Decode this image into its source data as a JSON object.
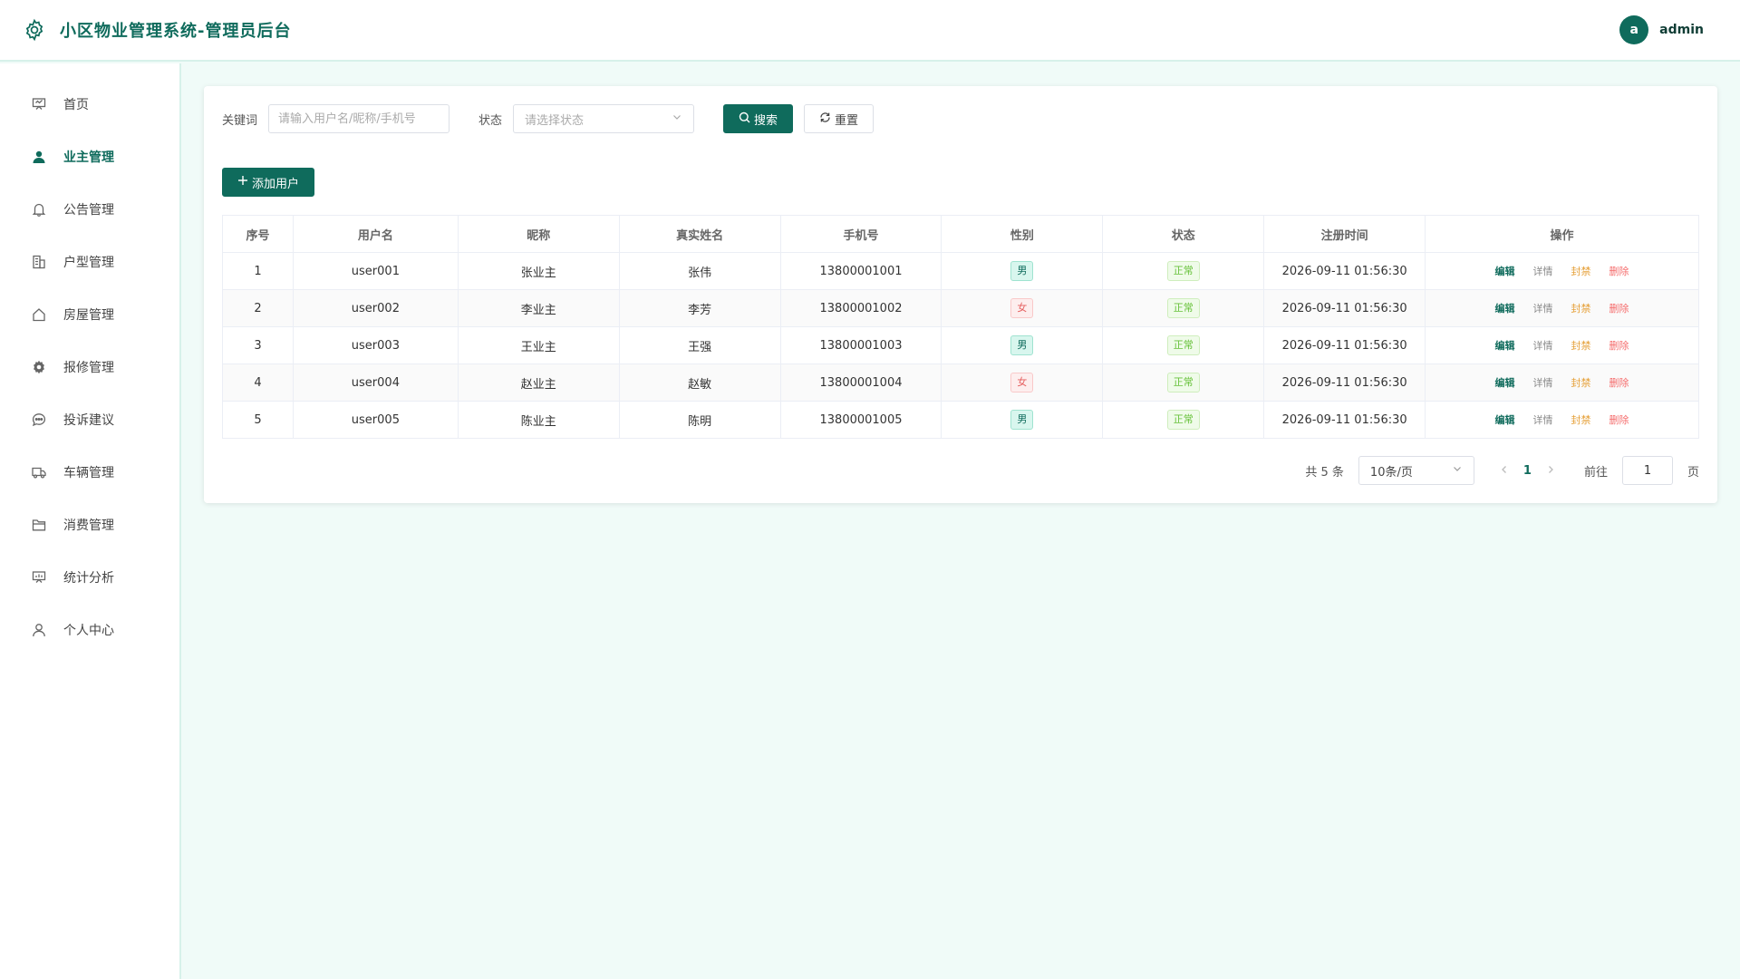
{
  "header": {
    "title": "小区物业管理系统-管理员后台",
    "avatar_letter": "a",
    "user_name": "admin"
  },
  "colors": {
    "primary": "#0f6b5c",
    "background": "#f0fbf8",
    "female": "#e55f5f",
    "ok": "#67c23a",
    "ban": "#e6a23c",
    "delete": "#f56c6c"
  },
  "sidebar": {
    "items": [
      {
        "label": "首页",
        "icon": "presentation-icon"
      },
      {
        "label": "业主管理",
        "icon": "user-filled-icon",
        "active": true
      },
      {
        "label": "公告管理",
        "icon": "bell-icon"
      },
      {
        "label": "户型管理",
        "icon": "building-icon"
      },
      {
        "label": "房屋管理",
        "icon": "house-icon"
      },
      {
        "label": "报修管理",
        "icon": "gear-icon"
      },
      {
        "label": "投诉建议",
        "icon": "chat-icon"
      },
      {
        "label": "车辆管理",
        "icon": "truck-icon"
      },
      {
        "label": "消费管理",
        "icon": "folder-icon"
      },
      {
        "label": "统计分析",
        "icon": "data-board-icon"
      },
      {
        "label": "个人中心",
        "icon": "user-icon"
      }
    ]
  },
  "filters": {
    "keyword_label": "关键词",
    "keyword_placeholder": "请输入用户名/昵称/手机号",
    "status_label": "状态",
    "status_placeholder": "请选择状态",
    "search_label": "搜索",
    "reset_label": "重置"
  },
  "add_button_label": "添加用户",
  "table": {
    "columns": [
      "序号",
      "用户名",
      "昵称",
      "真实姓名",
      "手机号",
      "性别",
      "状态",
      "注册时间",
      "操作"
    ],
    "rows": [
      {
        "index": "1",
        "username": "user001",
        "nickname": "张业主",
        "realname": "张伟",
        "phone": "13800001001",
        "gender": "男",
        "status": "正常",
        "registered": "2026-09-11 01:56:30"
      },
      {
        "index": "2",
        "username": "user002",
        "nickname": "李业主",
        "realname": "李芳",
        "phone": "13800001002",
        "gender": "女",
        "status": "正常",
        "registered": "2026-09-11 01:56:30"
      },
      {
        "index": "3",
        "username": "user003",
        "nickname": "王业主",
        "realname": "王强",
        "phone": "13800001003",
        "gender": "男",
        "status": "正常",
        "registered": "2026-09-11 01:56:30"
      },
      {
        "index": "4",
        "username": "user004",
        "nickname": "赵业主",
        "realname": "赵敏",
        "phone": "13800001004",
        "gender": "女",
        "status": "正常",
        "registered": "2026-09-11 01:56:30"
      },
      {
        "index": "5",
        "username": "user005",
        "nickname": "陈业主",
        "realname": "陈明",
        "phone": "13800001005",
        "gender": "男",
        "status": "正常",
        "registered": "2026-09-11 01:56:30"
      }
    ],
    "actions": {
      "edit": "编辑",
      "detail": "详情",
      "ban": "封禁",
      "delete": "删除"
    }
  },
  "pagination": {
    "total_text": "共 5 条",
    "page_size": "10条/页",
    "current_page": "1",
    "goto_label": "前往",
    "goto_value": "1",
    "page_suffix": "页"
  }
}
